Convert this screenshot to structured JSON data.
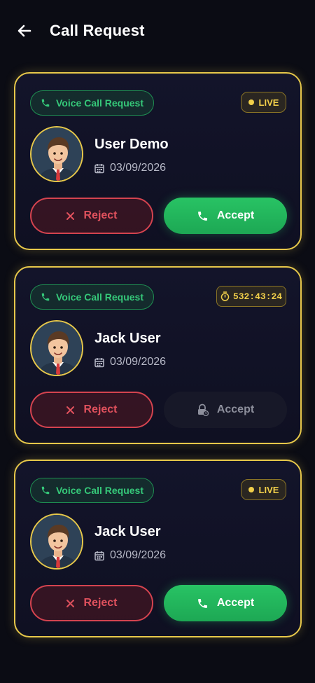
{
  "header": {
    "title": "Call Request",
    "back_icon": "arrow-left-icon"
  },
  "colors": {
    "accent_gold": "#e7c84a",
    "green": "#28c364",
    "red": "#d4434f",
    "background": "#0b0c14"
  },
  "cards": [
    {
      "type_label": "Voice Call Request",
      "status": "live",
      "status_label": "LIVE",
      "user_name": "User Demo",
      "date": "03/09/2026",
      "reject_label": "Reject",
      "accept_label": "Accept",
      "accept_state": "enabled"
    },
    {
      "type_label": "Voice Call Request",
      "status": "timer",
      "status_label": "532:43:24",
      "user_name": "Jack User",
      "date": "03/09/2026",
      "reject_label": "Reject",
      "accept_label": "Accept",
      "accept_state": "locked"
    },
    {
      "type_label": "Voice Call Request",
      "status": "live",
      "status_label": "LIVE",
      "user_name": "Jack User",
      "date": "03/09/2026",
      "reject_label": "Reject",
      "accept_label": "Accept",
      "accept_state": "enabled"
    }
  ]
}
